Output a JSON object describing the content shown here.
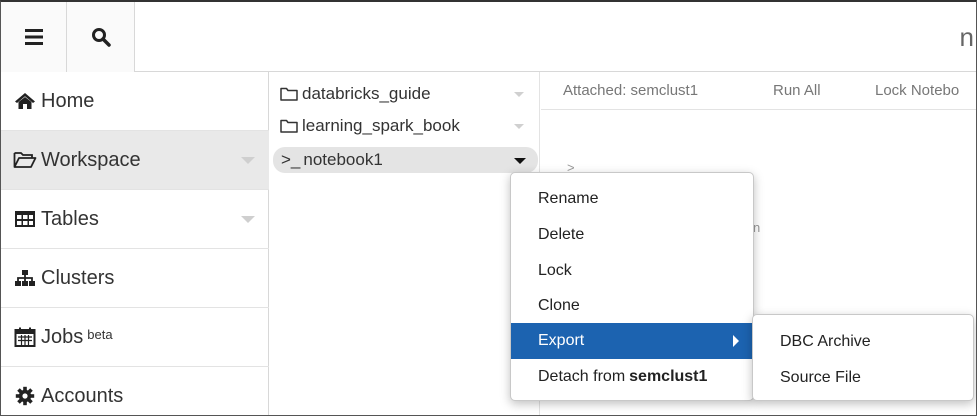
{
  "topbar": {
    "menu_icon": "hamburger-icon",
    "search_icon": "search-icon",
    "partial_title": "n"
  },
  "sidebar": {
    "items": [
      {
        "label": "Home",
        "icon": "home-icon",
        "sup": ""
      },
      {
        "label": "Workspace",
        "icon": "folder-open-icon",
        "sup": ""
      },
      {
        "label": "Tables",
        "icon": "table-icon",
        "sup": ""
      },
      {
        "label": "Clusters",
        "icon": "sitemap-icon",
        "sup": ""
      },
      {
        "label": "Jobs",
        "icon": "calendar-icon",
        "sup": "beta"
      },
      {
        "label": "Accounts",
        "icon": "gear-icon",
        "sup": ""
      }
    ]
  },
  "filelist": {
    "items": [
      {
        "label": "databricks_guide",
        "icon": "folder-icon"
      },
      {
        "label": "learning_spark_book",
        "icon": "folder-icon"
      },
      {
        "label": "notebook1",
        "prefix": ">_",
        "icon": "notebook-icon"
      }
    ]
  },
  "notebook": {
    "toolbar": {
      "attached": "Attached: semclust1",
      "run_all": "Run All",
      "lock": "Lock Notebo"
    },
    "cell_prompt": ">",
    "fragment": "n"
  },
  "context_menu": {
    "items": [
      "Rename",
      "Delete",
      "Lock",
      "Clone",
      "Export"
    ],
    "detach_prefix": "Detach from",
    "detach_target": "semclust1"
  },
  "export_submenu": {
    "items": [
      "DBC Archive",
      "Source File"
    ]
  },
  "colors": {
    "highlight": "#1c63b0",
    "active_sidebar": "#e9e9e9",
    "selected_file": "#e4e4e4"
  }
}
